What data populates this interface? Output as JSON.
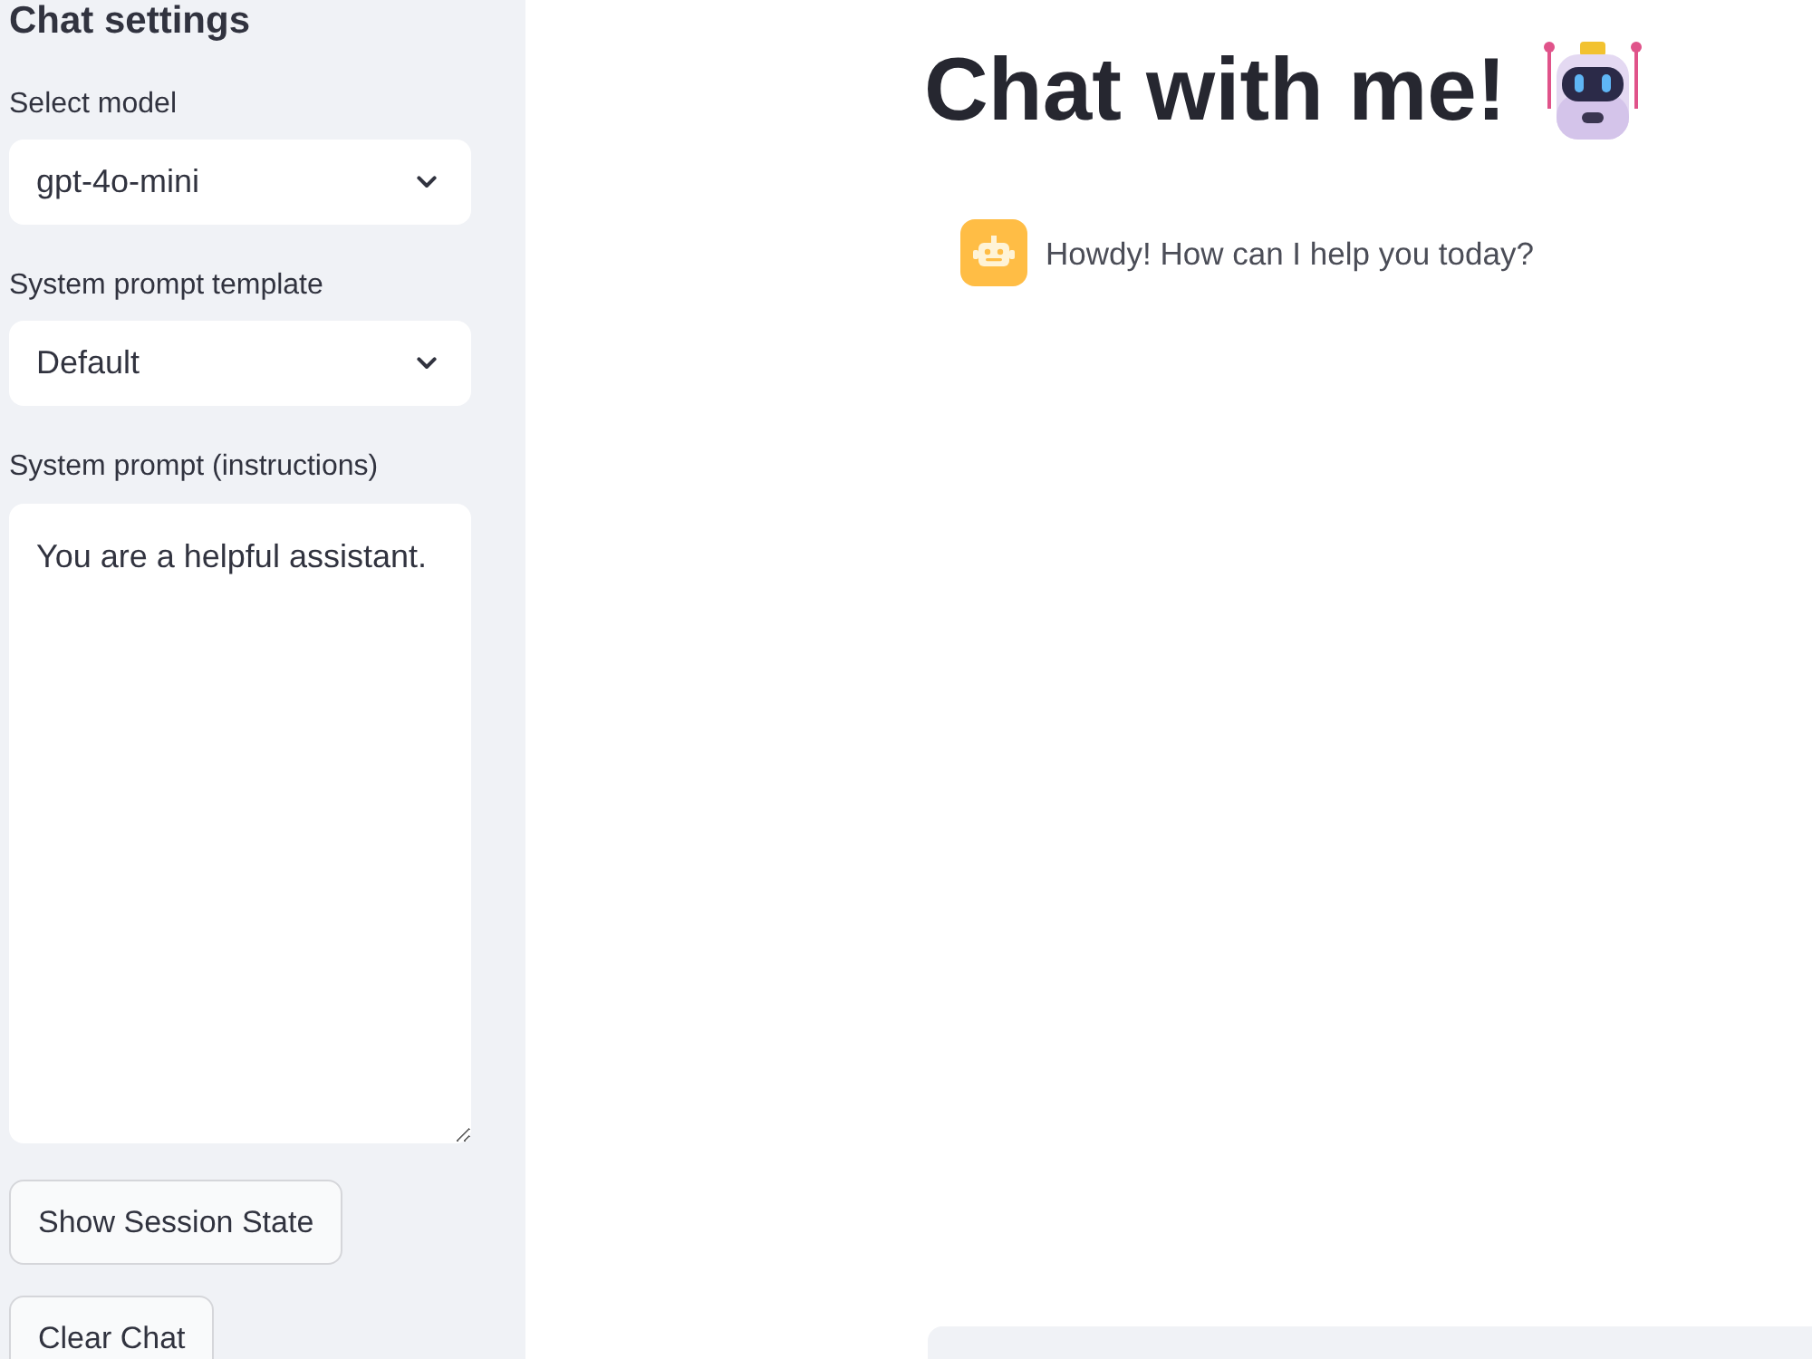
{
  "sidebar": {
    "title": "Chat settings",
    "fields": [
      {
        "kind": "select",
        "label": "Select model",
        "value": "gpt-4o-mini"
      },
      {
        "kind": "select",
        "label": "System prompt template",
        "value": "Default"
      },
      {
        "kind": "textarea",
        "label": "System prompt (instructions)",
        "value": "You are a helpful assistant."
      }
    ],
    "buttons": [
      "Show Session State",
      "Clear Chat"
    ]
  },
  "main": {
    "title": "Chat with me!",
    "messages": [
      {
        "kind": "bot",
        "text": "Howdy! How can I help you today?"
      }
    ]
  }
}
